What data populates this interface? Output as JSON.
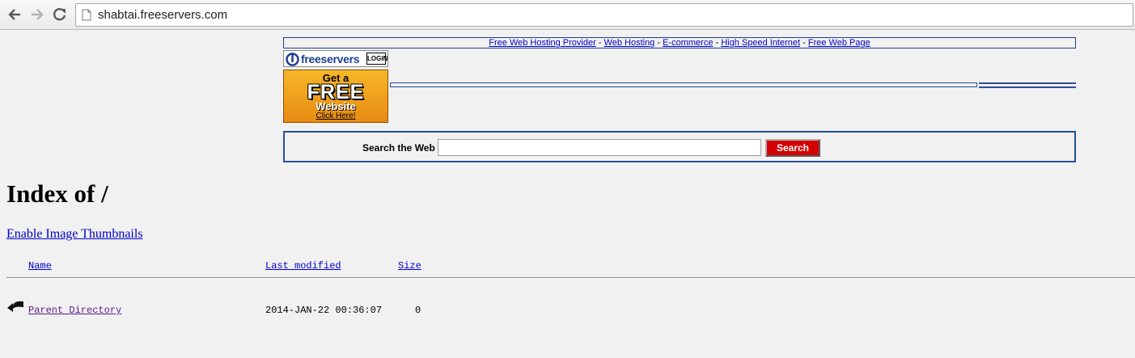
{
  "browser": {
    "url": "shabtai.freeservers.com"
  },
  "banner": {
    "links": [
      "Free Web Hosting Provider",
      "Web Hosting",
      "E-commerce",
      "High Speed Internet",
      "Free Web Page"
    ],
    "separator": " - ",
    "logo_text": "freeservers",
    "login_label": "LOGIN",
    "ad": {
      "line1": "Get a",
      "line2": "FREE",
      "line3": "Website",
      "line4": "Click Here!"
    },
    "search": {
      "label": "Search the Web",
      "input_value": "",
      "button_label": "Search"
    }
  },
  "index": {
    "title": "Index of /",
    "thumbnails_link": "Enable Image Thumbnails",
    "columns": {
      "name": "Name",
      "last_modified": "Last modified",
      "size": "Size"
    },
    "rows": [
      {
        "name": "Parent Directory",
        "last_modified": "2014-JAN-22 00:36:07",
        "size": "0"
      }
    ]
  },
  "colors": {
    "link": "#0000cc",
    "visited_link": "#551a8b",
    "banner_border": "#2a4d9a",
    "search_button": "#d40000",
    "ad_orange": "#f0a020"
  }
}
